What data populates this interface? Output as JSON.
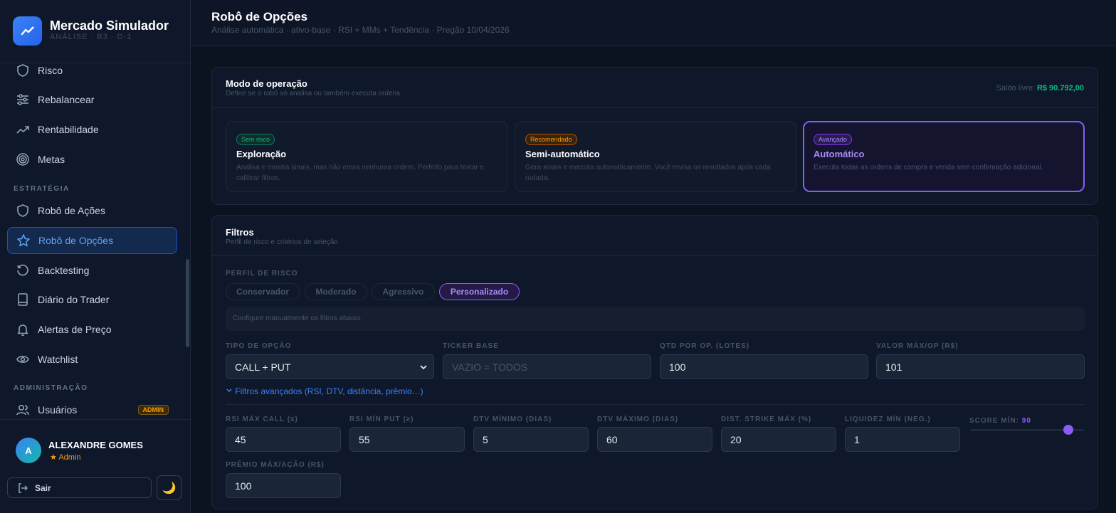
{
  "brand": {
    "title": "Mercado Simulador",
    "subtitle": "ANÁLISE · B3 · D-1"
  },
  "sidebar": {
    "items": [
      {
        "label": "Risco",
        "icon": "shield-icon"
      },
      {
        "label": "Rebalancear",
        "icon": "sliders-icon"
      },
      {
        "label": "Rentabilidade",
        "icon": "trending-up-icon"
      },
      {
        "label": "Metas",
        "icon": "target-icon"
      },
      {
        "label": "Robô de Ações",
        "icon": "robot-icon"
      },
      {
        "label": "Robô de Opções",
        "icon": "star-icon",
        "active": true
      },
      {
        "label": "Backtesting",
        "icon": "history-icon"
      },
      {
        "label": "Diário do Trader",
        "icon": "book-icon"
      },
      {
        "label": "Alertas de Preço",
        "icon": "bell-icon"
      },
      {
        "label": "Watchlist",
        "icon": "eye-icon"
      },
      {
        "label": "Usuários",
        "icon": "users-icon",
        "badge": "ADMIN"
      }
    ],
    "section_strategy": "ESTRATÉGIA",
    "section_admin": "ADMINISTRAÇÃO"
  },
  "user": {
    "initial": "A",
    "name": "ALEXANDRE GOMES",
    "role": "Admin",
    "logout": "Sair",
    "theme_icon": "🌙"
  },
  "header": {
    "title": "Robô de Opções",
    "subtitle": "Análise automática · ativo-base · RSI + MMs + Tendência · Pregão 10/04/2026"
  },
  "mode_card": {
    "title": "Modo de operação",
    "subtitle": "Define se o robô só analisa ou também executa ordens",
    "saldo_label": "Saldo livre:",
    "saldo_value": "R$ 90.792,00",
    "modes": [
      {
        "tag": "Sem risco",
        "title": "Exploração",
        "desc": "Analisa e mostra sinais, mas não envia nenhuma ordem. Perfeito para testar e calibrar filtros."
      },
      {
        "tag": "Recomendado",
        "title": "Semi-automático",
        "desc": "Gera sinais e executa automaticamente. Você revisa os resultados após cada rodada."
      },
      {
        "tag": "Avançado",
        "title": "Automático",
        "desc": "Executa todas as ordens de compra e venda sem confirmação adicional."
      }
    ]
  },
  "filters": {
    "title": "Filtros",
    "subtitle": "Perfil de risco e critérios de seleção",
    "risk_label": "PERFIL DE RISCO",
    "profiles": [
      "Conservador",
      "Moderado",
      "Agressivo",
      "Personalizado"
    ],
    "note": "Configure manualmente os filtros abaixo.",
    "tipo_label": "TIPO DE OPÇÃO",
    "tipo_value": "CALL + PUT",
    "ticker_label": "TICKER BASE",
    "ticker_placeholder": "VAZIO = TODOS",
    "qtd_label": "QTD POR OP. (LOTES)",
    "qtd_value": "100",
    "valor_label": "VALOR MÁX/OP (R$)",
    "valor_value": "101",
    "advanced": "Filtros avançados (RSI, DTV, distância, prêmio…)",
    "rsi_call_label": "RSI MÁX CALL (≤)",
    "rsi_call_value": "45",
    "rsi_put_label": "RSI MÍN PUT (≥)",
    "rsi_put_value": "55",
    "dtv_min_label": "DTV MÍNIMO (DIAS)",
    "dtv_min_value": "5",
    "dtv_max_label": "DTV MÁXIMO (DIAS)",
    "dtv_max_value": "60",
    "strike_label": "DIST. STRIKE MÁX (%)",
    "strike_value": "20",
    "liq_label": "LIQUIDEZ MÍN (NEG.)",
    "liq_value": "1",
    "score_label": "SCORE MÍN:",
    "score_value": "90",
    "premio_label": "PRÊMIO MÁX/AÇÃO (R$)",
    "premio_value": "100"
  },
  "colors": {
    "accent": "#3b82f6",
    "purple": "#8b5cf6",
    "green": "#10b981",
    "amber": "#f59e0b"
  }
}
